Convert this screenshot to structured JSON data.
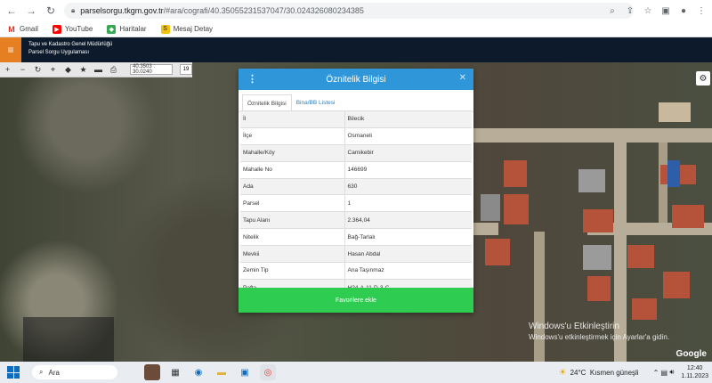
{
  "browser": {
    "url_host": "parselsorgu.tkgm.gov.tr",
    "url_path": "/#ara/cografi/40.35055231537047/30.024326080234385",
    "bookmarks": [
      {
        "label": "Gmail",
        "icon": "gmail-icon",
        "color": "#d93025"
      },
      {
        "label": "YouTube",
        "icon": "youtube-icon",
        "color": "#ff0000"
      },
      {
        "label": "Haritalar",
        "icon": "maps-icon",
        "color": "#34a853"
      },
      {
        "label": "Mesaj Detay",
        "icon": "s-icon",
        "color": "#f4c20d"
      }
    ]
  },
  "app": {
    "title_line1": "Tapu ve Kadastro Genel Müdürlüğü",
    "title_line2": "Parsel Sorgu Uygulaması"
  },
  "map": {
    "coords": "40.3503 : 30.0240",
    "zoom": "19",
    "google": "Google",
    "windows_line1": "Windows'u Etkinleştirin",
    "windows_line2": "Windows'u etkinleştirmek için Ayarlar'a gidin."
  },
  "modal": {
    "title": "Öznitelik Bilgisi",
    "tabs": [
      "Öznitelik Bilgisi",
      "Bina/BB Listesi"
    ],
    "rows": [
      {
        "key": "İl",
        "value": "Bilecik"
      },
      {
        "key": "İlçe",
        "value": "Osmaneli"
      },
      {
        "key": "Mahalle/Köy",
        "value": "Camikebir"
      },
      {
        "key": "Mahalle No",
        "value": "146699"
      },
      {
        "key": "Ada",
        "value": "630"
      },
      {
        "key": "Parsel",
        "value": "1"
      },
      {
        "key": "Tapu Alanı",
        "value": "2.364,04"
      },
      {
        "key": "Nitelik",
        "value": "Bağ-Tarlalı"
      },
      {
        "key": "Mevkii",
        "value": "Hasan Abdal"
      },
      {
        "key": "Zemin Tip",
        "value": "Ana Taşınmaz"
      },
      {
        "key": "Pafta",
        "value": "H24-A-11-D-3-C"
      }
    ],
    "fav_button": "Favorilere ekle",
    "header_color": "#2f97d9",
    "button_color": "#2ecc50"
  },
  "taskbar": {
    "search": "Ara",
    "weather_temp": "24°C",
    "weather_text": "Kısmen güneşli",
    "time": "12:40",
    "date": "1.11.2023"
  }
}
